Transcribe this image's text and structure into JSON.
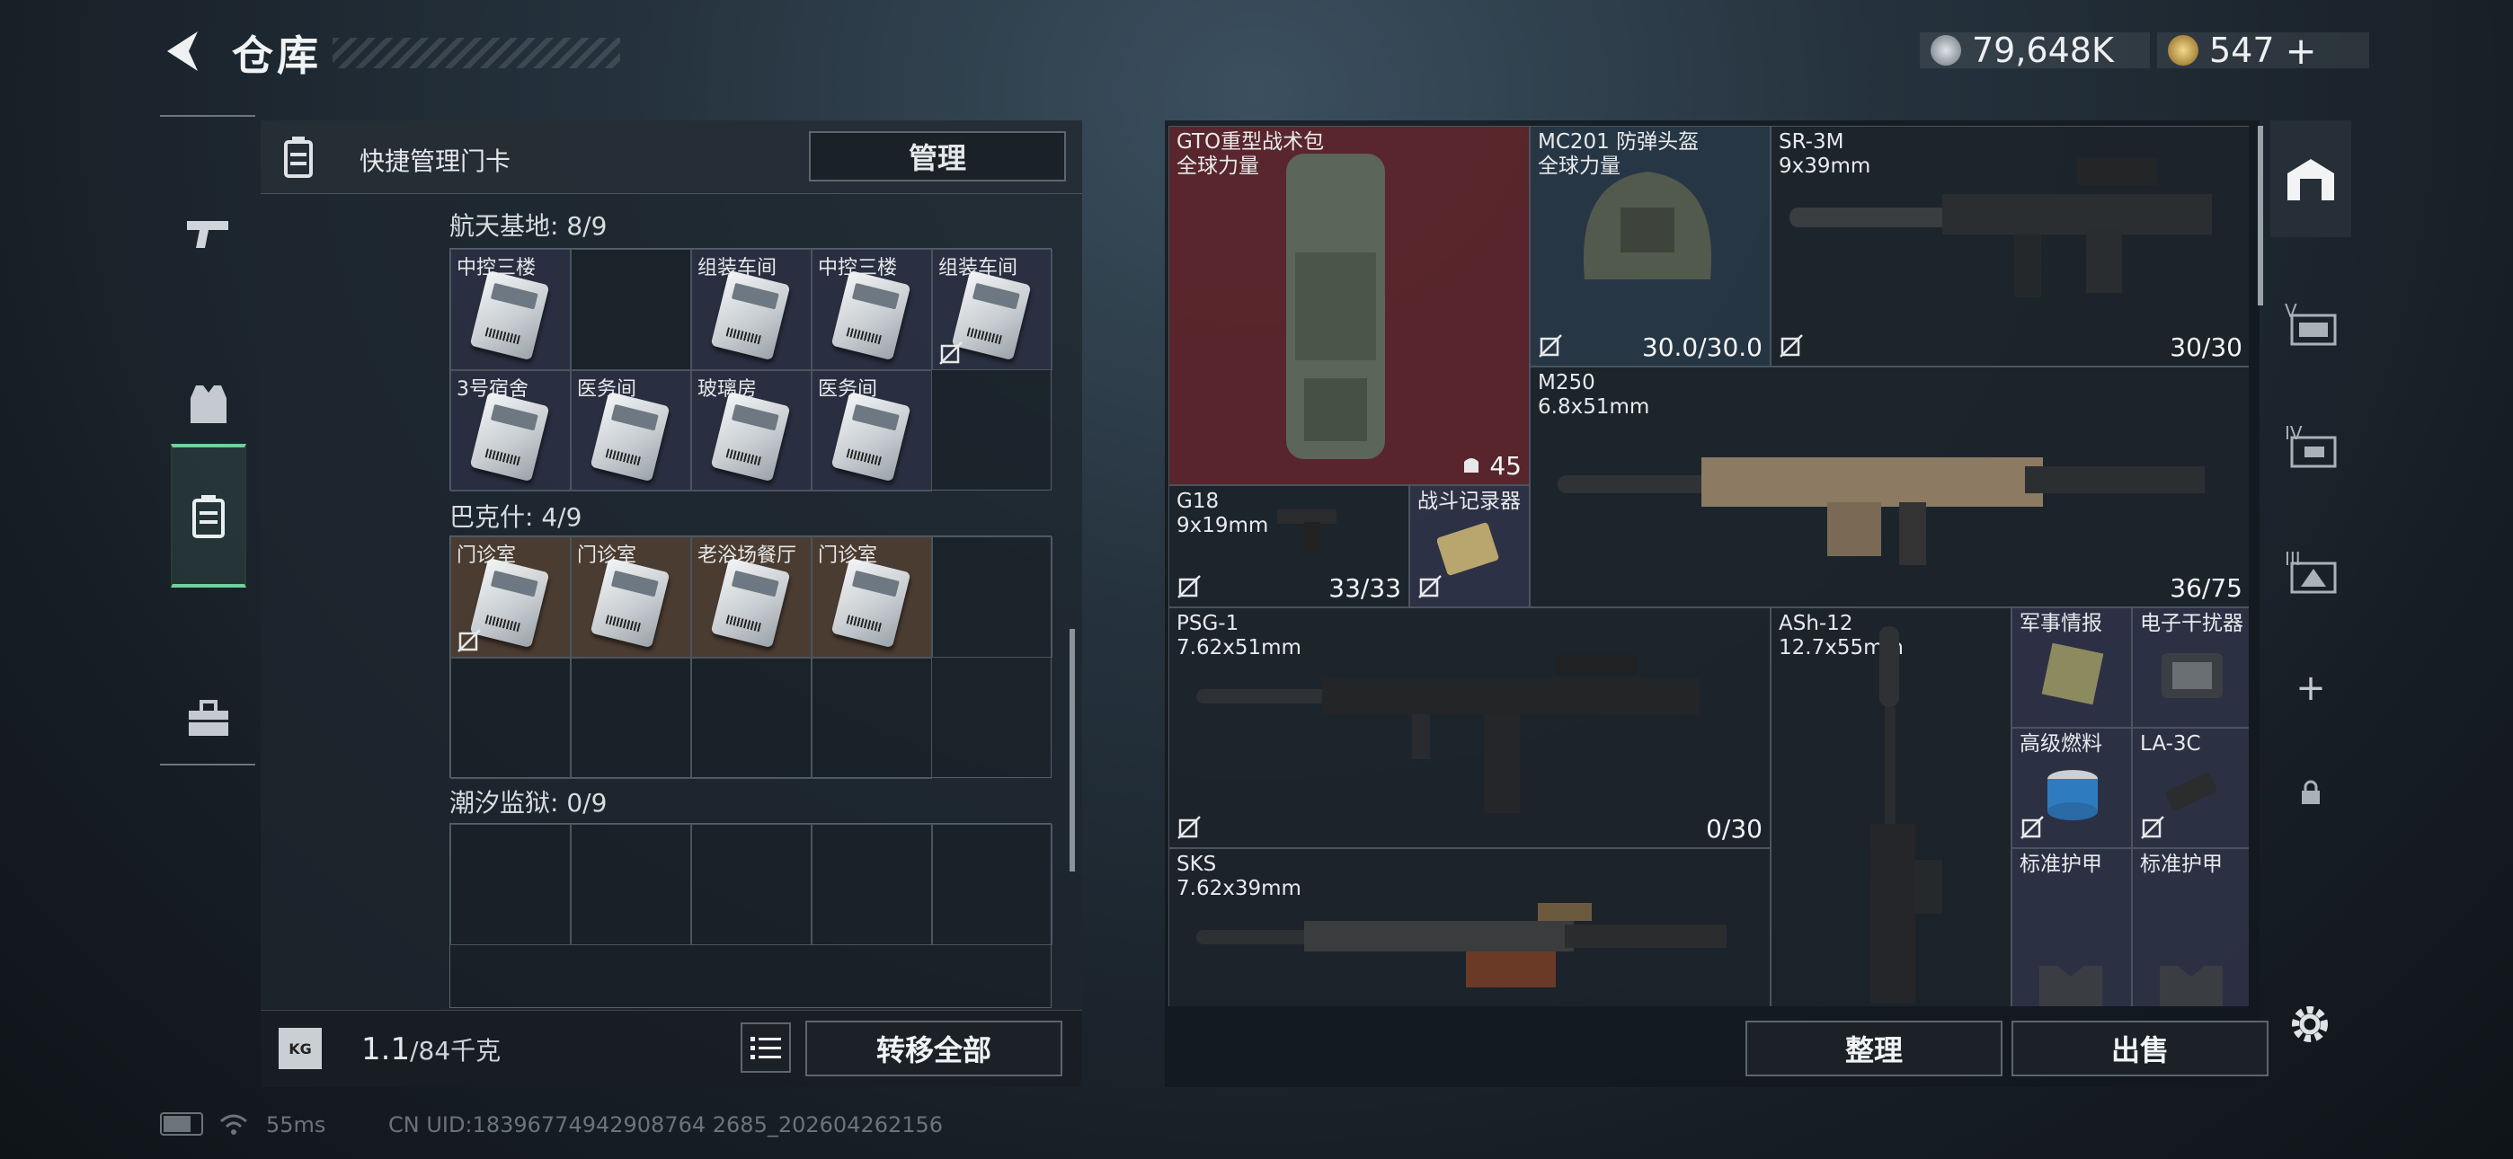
{
  "header": {
    "title": "仓库",
    "currency1": "79,648K",
    "currency2": "547",
    "currency2_plus": "+"
  },
  "left_panel": {
    "header_label": "快捷管理门卡",
    "manage_button": "管理",
    "sections": [
      {
        "title": "航天基地: 8/9",
        "cards": [
          "中控三楼",
          "",
          "组装车间",
          "中控三楼",
          "组装车间",
          "3号宿舍",
          "医务间",
          "玻璃房",
          "医务间"
        ]
      },
      {
        "title": "巴克什: 4/9",
        "cards": [
          "门诊室",
          "门诊室",
          "老浴场餐厅",
          "门诊室"
        ]
      },
      {
        "title": "潮汐监狱: 0/9",
        "cards": []
      }
    ],
    "weight_value": "1.1",
    "weight_total": "/84千克",
    "transfer_all_button": "转移全部"
  },
  "right_panel": {
    "items": [
      {
        "name": "GTO重型战术包\n全球力量",
        "count": "45"
      },
      {
        "name": "MC201 防弹头盔\n全球力量",
        "count": "30.0/30.0"
      },
      {
        "name": "SR-3M\n9x39mm",
        "count": "30/30"
      },
      {
        "name": "M250\n6.8x51mm",
        "count": "36/75"
      },
      {
        "name": "G18\n9x19mm",
        "count": "33/33"
      },
      {
        "name": "战斗记录器",
        "count": ""
      },
      {
        "name": "PSG-1\n7.62x51mm",
        "count": "0/30"
      },
      {
        "name": "ASh-12\n12.7x55mm",
        "count": ""
      },
      {
        "name": "军事情报",
        "count": ""
      },
      {
        "name": "电子干扰器",
        "count": ""
      },
      {
        "name": "高级燃料",
        "count": ""
      },
      {
        "name": "LA-3C",
        "count": ""
      },
      {
        "name": "SKS\n7.62x39mm",
        "count": ""
      },
      {
        "name": "标准护甲",
        "count": ""
      },
      {
        "name": "标准护甲",
        "count": ""
      }
    ],
    "sort_button": "整理",
    "sell_button": "出售"
  },
  "right_bar": {
    "add": "+"
  },
  "status": {
    "ping": "55ms",
    "uid": "CN UID:18396774942908764 2685_202604262156"
  },
  "colors": {
    "accent_green": "#6fd29a",
    "backpack_bg": "#5a2a2e",
    "keycard_brown": "#5b4634"
  }
}
